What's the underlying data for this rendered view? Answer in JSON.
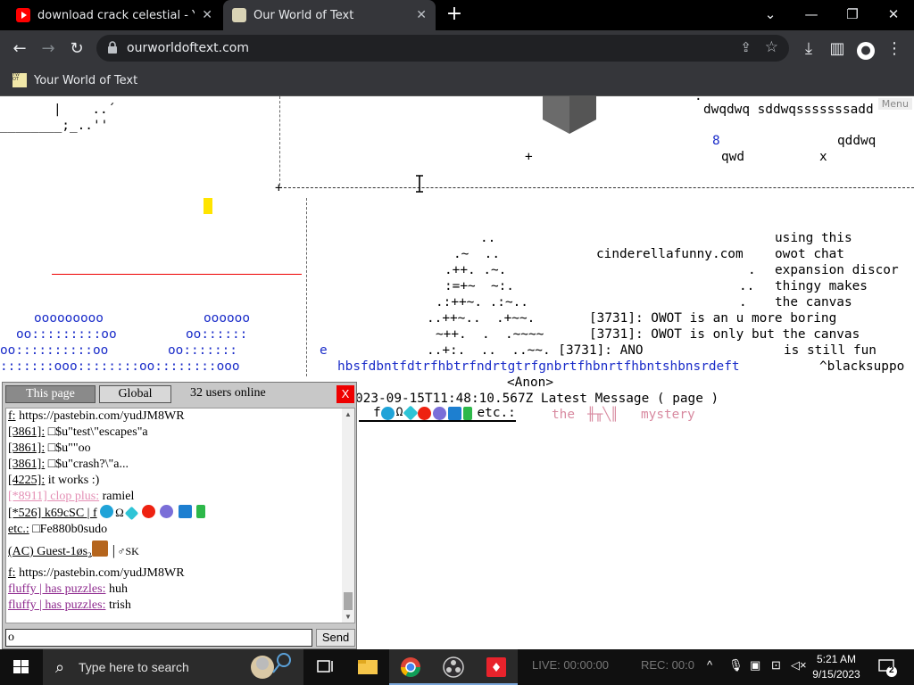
{
  "browser": {
    "tabs": [
      {
        "title": "download crack celestial - YouTu",
        "favicon": "youtube-icon",
        "color": "#ff0000"
      },
      {
        "title": "Our World of Text",
        "favicon": "owot-icon"
      }
    ],
    "new_tab_icon": "+",
    "url": "ourworldoftext.com",
    "bookmark": {
      "label": "Your World of Text",
      "icon_text": "YW OT"
    }
  },
  "canvas": {
    "menu_label": "Menu",
    "lines": {
      "t1": "|    ..´",
      "t2": "________;_..''",
      "t3": "dwqdwq sddwqsssssssadd",
      "t4": "8",
      "t5": "qddwq",
      "t6": "+",
      "t7": "qwd",
      "t8": "x",
      "t9": "..",
      "t10": ".~  ..",
      "t11": "cinderellafunny.com",
      "t12": "using this",
      "t13": "owot chat",
      "t14": ".++. .~.",
      "t15": ".",
      "t16": "expansion discor",
      "t17": ":=+~  ~:.",
      "t18": "..",
      "t19": "thingy makes",
      "t20": ".:++~. .:~..",
      "t21": ".",
      "t22": "the canvas",
      "t23": "..++~..  .+~~.",
      "t24": "[3731]: OWOT is an u more boring",
      "t25": "~++.  .  .~~~~",
      "t26": "[3731]: OWOT is only but the canvas",
      "t27": "..+:.  ..  ..~~. [3731]: ANO",
      "t28": "is still fun",
      "o1": "ooooooooo",
      "o2": "oooooo",
      "o3": "oo:::::::::oo",
      "o4": "oo::::::",
      "o5": "oo::::::::::oo",
      "o6": "oo:::::::",
      "o7": ":::::::ooo::::::::oo::::::::ooo",
      "e": "e",
      "hbs": "hbsfdbntfdtrfhbtrfndrtgtrfgnbrtfhbnrtfhbntshbnsrdeft",
      "blacksupp": "^blacksuppo",
      "ts": "023-09-15T11:48:10.567Z Latest Message ( page )",
      "anon": "<Anon>",
      "fetc_f": "f",
      "fetc_etc": "etc.:",
      "mystery1": "the",
      "mystery2": "mystery"
    }
  },
  "chat": {
    "tab_page": "This page",
    "tab_global": "Global",
    "users_online": "32 users online",
    "close_label": "X",
    "messages": [
      {
        "nick": "f:",
        "text": " https://pastebin.com/yudJM8WR"
      },
      {
        "nick": "[3861]:",
        "text": " □$u\"test\\\"escapes\"a"
      },
      {
        "nick": "[3861]:",
        "text": " □$u\"\"oo"
      },
      {
        "nick": "[3861]:",
        "text": " □$u\"crash?\\\"a..."
      },
      {
        "nick": "[4225]:",
        "text": " it works :)"
      },
      {
        "nick": "[*8911] clop plus:",
        "text": " ramiel"
      },
      {
        "nick": "[*526] k69cSC | f",
        "text": ""
      },
      {
        "nick": "etc.:",
        "text": " □Fe880b0sudo"
      },
      {
        "nick": "(AC) Guest-1øs₂",
        "text": "│♂SK"
      },
      {
        "nick": "f:",
        "text": " https://pastebin.com/yudJM8WR"
      },
      {
        "nick": "fluffy | has puzzles:",
        "text": " huh"
      },
      {
        "nick": "fluffy | has puzzles:",
        "text": " trish"
      }
    ],
    "input_value": "o",
    "send_label": "Send"
  },
  "taskbar": {
    "search_placeholder": "Type here to search",
    "tray_live": "LIVE: 00:00:00",
    "tray_rec": "REC: 00:0",
    "time": "5:21 AM",
    "date": "9/15/2023",
    "notif_count": "2"
  }
}
